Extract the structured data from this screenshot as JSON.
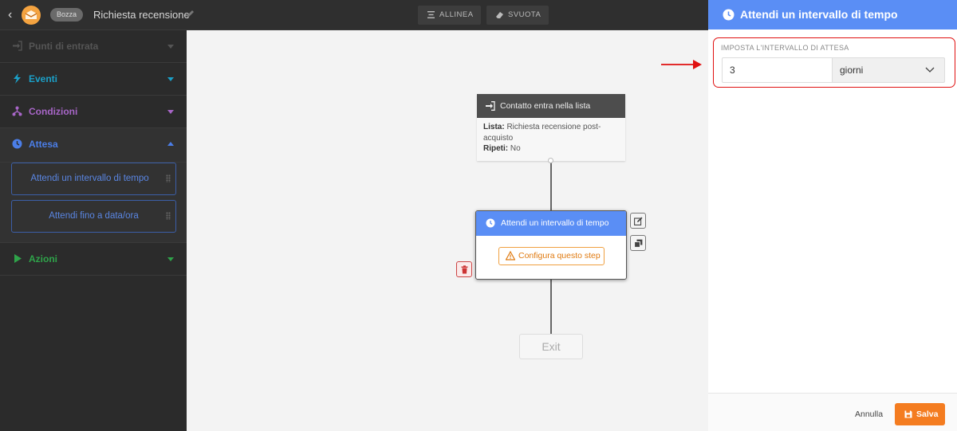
{
  "topbar": {
    "badge": "Bozza",
    "title": "Richiesta recensione",
    "align_label": "ALLINEA",
    "clear_label": "SVUOTA"
  },
  "sidebar": {
    "sections": {
      "entry": "Punti di entrata",
      "events": "Eventi",
      "conditions": "Condizioni",
      "wait": "Attesa",
      "actions": "Azioni"
    },
    "wait_items": [
      "Attendi un intervallo di tempo",
      "Attendi fino a data/ora"
    ]
  },
  "canvas": {
    "entry_node": {
      "title": "Contatto entra nella lista",
      "list_label": "Lista:",
      "list_value": "Richiesta recensione post-acquisto",
      "repeat_label": "Ripeti:",
      "repeat_value": "No"
    },
    "wait_node": {
      "title": "Attendi un intervallo di tempo",
      "configure_label": "Configura questo step"
    },
    "exit_label": "Exit"
  },
  "panel": {
    "title": "Attendi un intervallo di tempo",
    "field_label": "IMPOSTA L'INTERVALLO DI ATTESA",
    "interval_value": "3",
    "unit_value": "giorni",
    "cancel_label": "Annulla",
    "save_label": "Salva"
  },
  "colors": {
    "accent_blue": "#5a8ef5",
    "save_orange": "#f47c20",
    "highlight_red": "#e01010",
    "events_cyan": "#1ba0c8",
    "conditions_purple": "#a866c8",
    "actions_green": "#2fa34a"
  }
}
